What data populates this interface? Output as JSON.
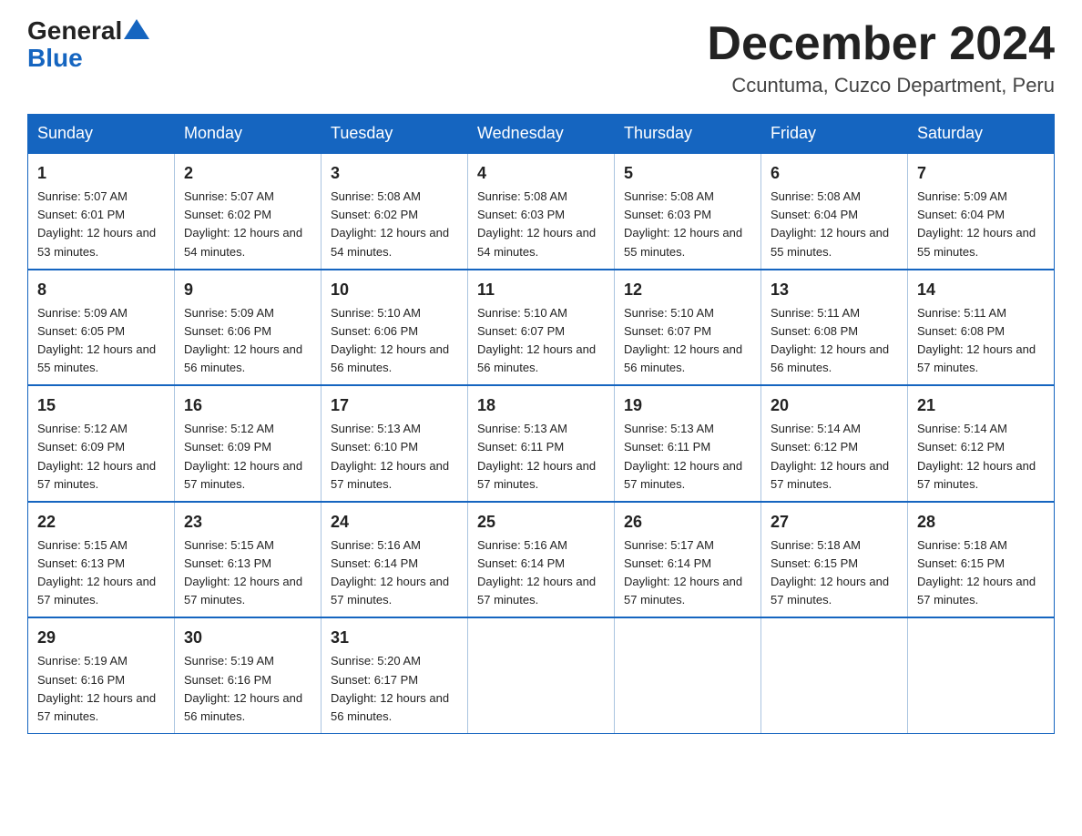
{
  "header": {
    "logo_general": "General",
    "logo_blue": "Blue",
    "month_title": "December 2024",
    "location": "Ccuntuma, Cuzco Department, Peru"
  },
  "weekdays": [
    "Sunday",
    "Monday",
    "Tuesday",
    "Wednesday",
    "Thursday",
    "Friday",
    "Saturday"
  ],
  "weeks": [
    [
      {
        "day": "1",
        "sunrise": "5:07 AM",
        "sunset": "6:01 PM",
        "daylight": "12 hours and 53 minutes."
      },
      {
        "day": "2",
        "sunrise": "5:07 AM",
        "sunset": "6:02 PM",
        "daylight": "12 hours and 54 minutes."
      },
      {
        "day": "3",
        "sunrise": "5:08 AM",
        "sunset": "6:02 PM",
        "daylight": "12 hours and 54 minutes."
      },
      {
        "day": "4",
        "sunrise": "5:08 AM",
        "sunset": "6:03 PM",
        "daylight": "12 hours and 54 minutes."
      },
      {
        "day": "5",
        "sunrise": "5:08 AM",
        "sunset": "6:03 PM",
        "daylight": "12 hours and 55 minutes."
      },
      {
        "day": "6",
        "sunrise": "5:08 AM",
        "sunset": "6:04 PM",
        "daylight": "12 hours and 55 minutes."
      },
      {
        "day": "7",
        "sunrise": "5:09 AM",
        "sunset": "6:04 PM",
        "daylight": "12 hours and 55 minutes."
      }
    ],
    [
      {
        "day": "8",
        "sunrise": "5:09 AM",
        "sunset": "6:05 PM",
        "daylight": "12 hours and 55 minutes."
      },
      {
        "day": "9",
        "sunrise": "5:09 AM",
        "sunset": "6:06 PM",
        "daylight": "12 hours and 56 minutes."
      },
      {
        "day": "10",
        "sunrise": "5:10 AM",
        "sunset": "6:06 PM",
        "daylight": "12 hours and 56 minutes."
      },
      {
        "day": "11",
        "sunrise": "5:10 AM",
        "sunset": "6:07 PM",
        "daylight": "12 hours and 56 minutes."
      },
      {
        "day": "12",
        "sunrise": "5:10 AM",
        "sunset": "6:07 PM",
        "daylight": "12 hours and 56 minutes."
      },
      {
        "day": "13",
        "sunrise": "5:11 AM",
        "sunset": "6:08 PM",
        "daylight": "12 hours and 56 minutes."
      },
      {
        "day": "14",
        "sunrise": "5:11 AM",
        "sunset": "6:08 PM",
        "daylight": "12 hours and 57 minutes."
      }
    ],
    [
      {
        "day": "15",
        "sunrise": "5:12 AM",
        "sunset": "6:09 PM",
        "daylight": "12 hours and 57 minutes."
      },
      {
        "day": "16",
        "sunrise": "5:12 AM",
        "sunset": "6:09 PM",
        "daylight": "12 hours and 57 minutes."
      },
      {
        "day": "17",
        "sunrise": "5:13 AM",
        "sunset": "6:10 PM",
        "daylight": "12 hours and 57 minutes."
      },
      {
        "day": "18",
        "sunrise": "5:13 AM",
        "sunset": "6:11 PM",
        "daylight": "12 hours and 57 minutes."
      },
      {
        "day": "19",
        "sunrise": "5:13 AM",
        "sunset": "6:11 PM",
        "daylight": "12 hours and 57 minutes."
      },
      {
        "day": "20",
        "sunrise": "5:14 AM",
        "sunset": "6:12 PM",
        "daylight": "12 hours and 57 minutes."
      },
      {
        "day": "21",
        "sunrise": "5:14 AM",
        "sunset": "6:12 PM",
        "daylight": "12 hours and 57 minutes."
      }
    ],
    [
      {
        "day": "22",
        "sunrise": "5:15 AM",
        "sunset": "6:13 PM",
        "daylight": "12 hours and 57 minutes."
      },
      {
        "day": "23",
        "sunrise": "5:15 AM",
        "sunset": "6:13 PM",
        "daylight": "12 hours and 57 minutes."
      },
      {
        "day": "24",
        "sunrise": "5:16 AM",
        "sunset": "6:14 PM",
        "daylight": "12 hours and 57 minutes."
      },
      {
        "day": "25",
        "sunrise": "5:16 AM",
        "sunset": "6:14 PM",
        "daylight": "12 hours and 57 minutes."
      },
      {
        "day": "26",
        "sunrise": "5:17 AM",
        "sunset": "6:14 PM",
        "daylight": "12 hours and 57 minutes."
      },
      {
        "day": "27",
        "sunrise": "5:18 AM",
        "sunset": "6:15 PM",
        "daylight": "12 hours and 57 minutes."
      },
      {
        "day": "28",
        "sunrise": "5:18 AM",
        "sunset": "6:15 PM",
        "daylight": "12 hours and 57 minutes."
      }
    ],
    [
      {
        "day": "29",
        "sunrise": "5:19 AM",
        "sunset": "6:16 PM",
        "daylight": "12 hours and 57 minutes."
      },
      {
        "day": "30",
        "sunrise": "5:19 AM",
        "sunset": "6:16 PM",
        "daylight": "12 hours and 56 minutes."
      },
      {
        "day": "31",
        "sunrise": "5:20 AM",
        "sunset": "6:17 PM",
        "daylight": "12 hours and 56 minutes."
      },
      null,
      null,
      null,
      null
    ]
  ]
}
